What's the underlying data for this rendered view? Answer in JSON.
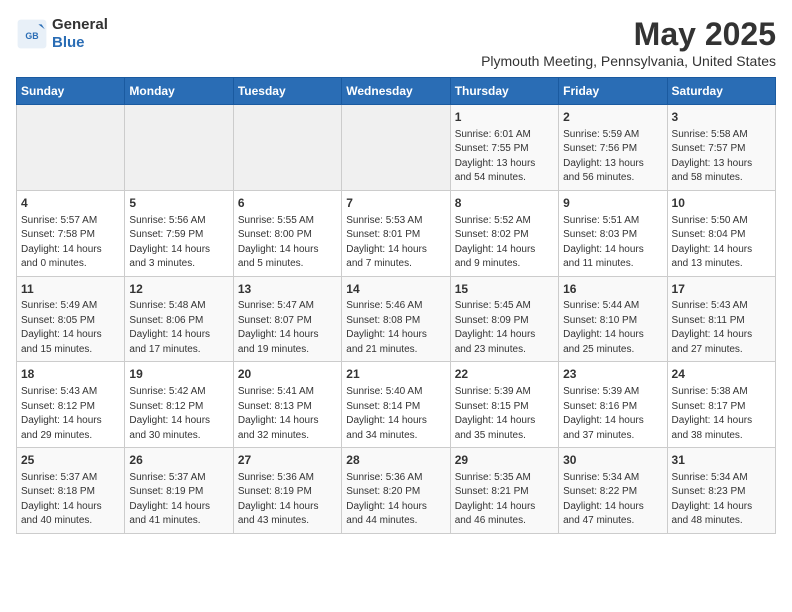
{
  "logo": {
    "line1": "General",
    "line2": "Blue"
  },
  "title": "May 2025",
  "subtitle": "Plymouth Meeting, Pennsylvania, United States",
  "header_color": "#2a6db5",
  "days_of_week": [
    "Sunday",
    "Monday",
    "Tuesday",
    "Wednesday",
    "Thursday",
    "Friday",
    "Saturday"
  ],
  "weeks": [
    [
      {
        "num": "",
        "info": ""
      },
      {
        "num": "",
        "info": ""
      },
      {
        "num": "",
        "info": ""
      },
      {
        "num": "",
        "info": ""
      },
      {
        "num": "1",
        "info": "Sunrise: 6:01 AM\nSunset: 7:55 PM\nDaylight: 13 hours\nand 54 minutes."
      },
      {
        "num": "2",
        "info": "Sunrise: 5:59 AM\nSunset: 7:56 PM\nDaylight: 13 hours\nand 56 minutes."
      },
      {
        "num": "3",
        "info": "Sunrise: 5:58 AM\nSunset: 7:57 PM\nDaylight: 13 hours\nand 58 minutes."
      }
    ],
    [
      {
        "num": "4",
        "info": "Sunrise: 5:57 AM\nSunset: 7:58 PM\nDaylight: 14 hours\nand 0 minutes."
      },
      {
        "num": "5",
        "info": "Sunrise: 5:56 AM\nSunset: 7:59 PM\nDaylight: 14 hours\nand 3 minutes."
      },
      {
        "num": "6",
        "info": "Sunrise: 5:55 AM\nSunset: 8:00 PM\nDaylight: 14 hours\nand 5 minutes."
      },
      {
        "num": "7",
        "info": "Sunrise: 5:53 AM\nSunset: 8:01 PM\nDaylight: 14 hours\nand 7 minutes."
      },
      {
        "num": "8",
        "info": "Sunrise: 5:52 AM\nSunset: 8:02 PM\nDaylight: 14 hours\nand 9 minutes."
      },
      {
        "num": "9",
        "info": "Sunrise: 5:51 AM\nSunset: 8:03 PM\nDaylight: 14 hours\nand 11 minutes."
      },
      {
        "num": "10",
        "info": "Sunrise: 5:50 AM\nSunset: 8:04 PM\nDaylight: 14 hours\nand 13 minutes."
      }
    ],
    [
      {
        "num": "11",
        "info": "Sunrise: 5:49 AM\nSunset: 8:05 PM\nDaylight: 14 hours\nand 15 minutes."
      },
      {
        "num": "12",
        "info": "Sunrise: 5:48 AM\nSunset: 8:06 PM\nDaylight: 14 hours\nand 17 minutes."
      },
      {
        "num": "13",
        "info": "Sunrise: 5:47 AM\nSunset: 8:07 PM\nDaylight: 14 hours\nand 19 minutes."
      },
      {
        "num": "14",
        "info": "Sunrise: 5:46 AM\nSunset: 8:08 PM\nDaylight: 14 hours\nand 21 minutes."
      },
      {
        "num": "15",
        "info": "Sunrise: 5:45 AM\nSunset: 8:09 PM\nDaylight: 14 hours\nand 23 minutes."
      },
      {
        "num": "16",
        "info": "Sunrise: 5:44 AM\nSunset: 8:10 PM\nDaylight: 14 hours\nand 25 minutes."
      },
      {
        "num": "17",
        "info": "Sunrise: 5:43 AM\nSunset: 8:11 PM\nDaylight: 14 hours\nand 27 minutes."
      }
    ],
    [
      {
        "num": "18",
        "info": "Sunrise: 5:43 AM\nSunset: 8:12 PM\nDaylight: 14 hours\nand 29 minutes."
      },
      {
        "num": "19",
        "info": "Sunrise: 5:42 AM\nSunset: 8:12 PM\nDaylight: 14 hours\nand 30 minutes."
      },
      {
        "num": "20",
        "info": "Sunrise: 5:41 AM\nSunset: 8:13 PM\nDaylight: 14 hours\nand 32 minutes."
      },
      {
        "num": "21",
        "info": "Sunrise: 5:40 AM\nSunset: 8:14 PM\nDaylight: 14 hours\nand 34 minutes."
      },
      {
        "num": "22",
        "info": "Sunrise: 5:39 AM\nSunset: 8:15 PM\nDaylight: 14 hours\nand 35 minutes."
      },
      {
        "num": "23",
        "info": "Sunrise: 5:39 AM\nSunset: 8:16 PM\nDaylight: 14 hours\nand 37 minutes."
      },
      {
        "num": "24",
        "info": "Sunrise: 5:38 AM\nSunset: 8:17 PM\nDaylight: 14 hours\nand 38 minutes."
      }
    ],
    [
      {
        "num": "25",
        "info": "Sunrise: 5:37 AM\nSunset: 8:18 PM\nDaylight: 14 hours\nand 40 minutes."
      },
      {
        "num": "26",
        "info": "Sunrise: 5:37 AM\nSunset: 8:19 PM\nDaylight: 14 hours\nand 41 minutes."
      },
      {
        "num": "27",
        "info": "Sunrise: 5:36 AM\nSunset: 8:19 PM\nDaylight: 14 hours\nand 43 minutes."
      },
      {
        "num": "28",
        "info": "Sunrise: 5:36 AM\nSunset: 8:20 PM\nDaylight: 14 hours\nand 44 minutes."
      },
      {
        "num": "29",
        "info": "Sunrise: 5:35 AM\nSunset: 8:21 PM\nDaylight: 14 hours\nand 46 minutes."
      },
      {
        "num": "30",
        "info": "Sunrise: 5:34 AM\nSunset: 8:22 PM\nDaylight: 14 hours\nand 47 minutes."
      },
      {
        "num": "31",
        "info": "Sunrise: 5:34 AM\nSunset: 8:23 PM\nDaylight: 14 hours\nand 48 minutes."
      }
    ]
  ]
}
